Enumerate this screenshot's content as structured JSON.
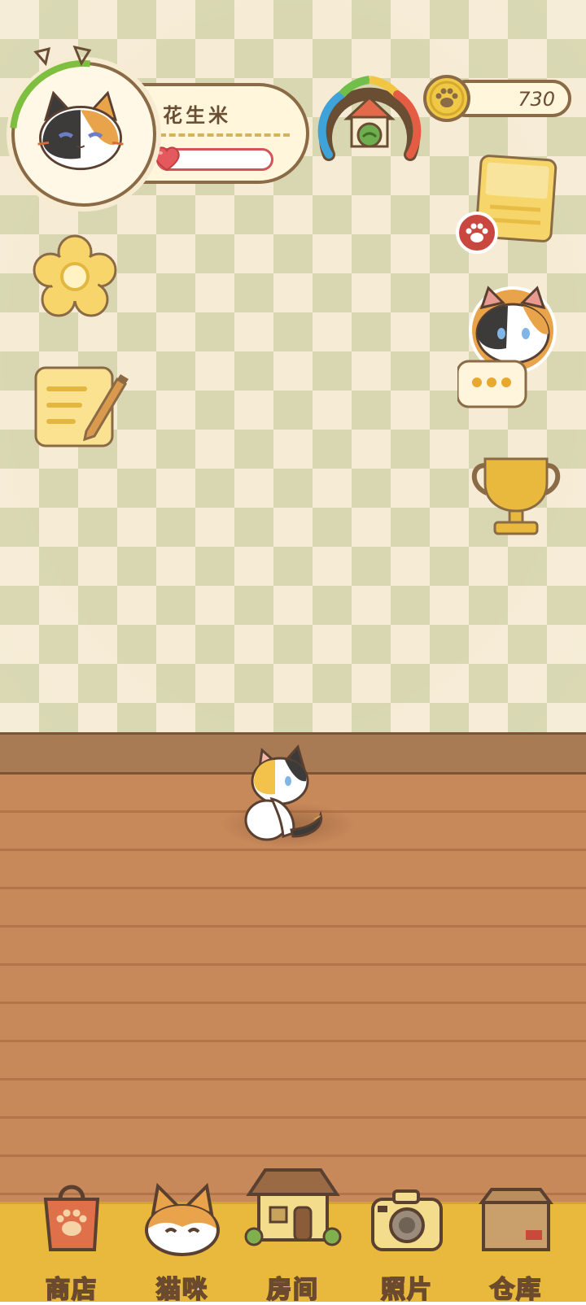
{
  "profile": {
    "name": "花生米",
    "affection_level": 0.08,
    "progress_ring": 0.12
  },
  "coins": {
    "value": "730"
  },
  "bottom_nav": {
    "items": [
      {
        "label": "商店",
        "icon": "shop-bag-icon"
      },
      {
        "label": "猫咪",
        "icon": "cat-face-icon"
      },
      {
        "label": "房间",
        "icon": "house-icon"
      },
      {
        "label": "照片",
        "icon": "camera-icon"
      },
      {
        "label": "仓库",
        "icon": "box-icon"
      }
    ]
  },
  "side_buttons": {
    "left": [
      "settings-flower-icon",
      "notepad-pencil-icon"
    ],
    "right": [
      "notice-paper-icon",
      "cat-chat-icon",
      "trophy-icon"
    ]
  },
  "colors": {
    "wall_light": "#f6ecd6",
    "wall_dark": "#d8d7b1",
    "floor": "#c8895a",
    "nav_bar": "#e8b93c",
    "outline": "#8b6a46"
  }
}
